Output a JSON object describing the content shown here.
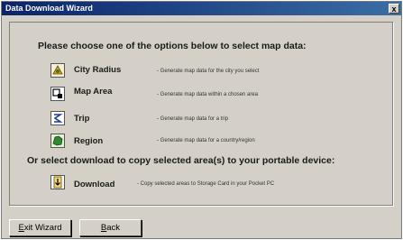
{
  "window": {
    "title": "Data Download Wizard",
    "close_glyph": "x"
  },
  "main": {
    "prompt": "Please choose one of the options below to select map data:",
    "options": [
      {
        "label": "City Radius",
        "desc": "- Generate map data for the city you select",
        "icon": "city-radius-icon"
      },
      {
        "label": "Map Area",
        "desc": "- Generate map data within a chosen area",
        "icon": "map-area-icon"
      },
      {
        "label": "Trip",
        "desc": "- Generate map data for a trip",
        "icon": "trip-icon"
      },
      {
        "label": "Region",
        "desc": "- Generate map data for a  country/region",
        "icon": "region-icon"
      }
    ],
    "prompt2": "Or select download to copy selected area(s) to your portable device:",
    "download": {
      "label": "Download",
      "desc": "- Copy selected areas to Storage Card in your Pocket PC",
      "icon": "download-icon"
    }
  },
  "footer": {
    "exit_first": "E",
    "exit_rest": "xit Wizard",
    "back_first": "B",
    "back_rest": "ack"
  }
}
